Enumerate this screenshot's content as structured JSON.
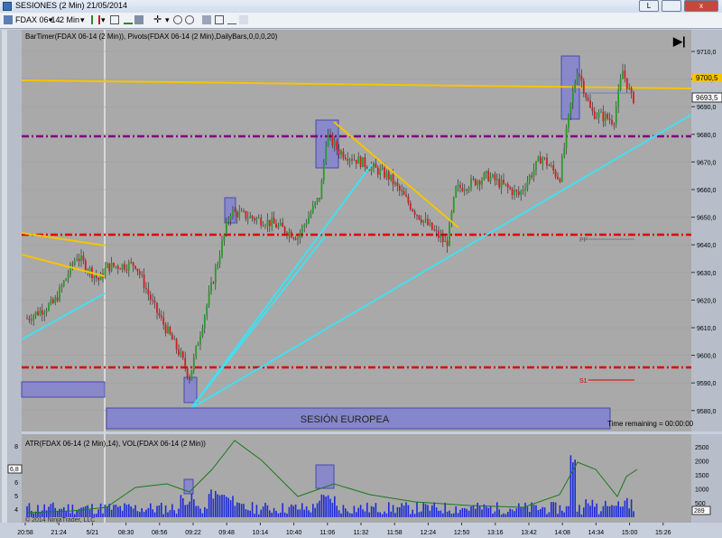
{
  "window": {
    "title": "SESIONES (2 Min)  21/05/2014",
    "min_label": "L",
    "close_label": "x"
  },
  "toolbar": {
    "instrument": "FDAX 06-14",
    "interval": "2 Min"
  },
  "price_panel": {
    "indicator_label": "BarTimer(FDAX 06-14 (2 Min)), Pivots(FDAX 06-14 (2 Min),DailyBars,0,0,0,20)",
    "price_ticks": [
      "9710,0",
      "9700,0",
      "9690,0",
      "9680,0",
      "9670,0",
      "9660,0",
      "9650,0",
      "9640,0",
      "9630,0",
      "9620,0",
      "9610,0",
      "9600,0",
      "9590,0",
      "9580,0"
    ],
    "price_ticks_num": [
      9710,
      9700,
      9690,
      9680,
      9670,
      9660,
      9650,
      9640,
      9630,
      9620,
      9610,
      9600,
      9590,
      9580
    ],
    "yellow_level_label": "9700,5",
    "last_price_label": "9693,5",
    "pivot_label": "PP",
    "s1_label": "S1",
    "session_label": "SESIÓN EUROPEA",
    "time_remaining": "Time remaining = 00:00:00",
    "colors": {
      "background": "#a9a9a9",
      "pivot": "#e00000",
      "r1": "#800080",
      "trend": "#40e0f0",
      "resistance": "#f5c400",
      "box": "#7b7bd8"
    }
  },
  "lower_panel": {
    "indicator_label": "ATR(FDAX 06-14 (2 Min),14), VOL(FDAX 06-14 (2 Min))",
    "atr_ticks": [
      "8",
      "6",
      "5",
      "4"
    ],
    "vol_ticks": [
      "2500",
      "2000",
      "1500",
      "1000",
      "500"
    ],
    "atr_marker": "6,8",
    "vol_marker": "289",
    "copyright": "© 2014 NinjaTrader, LLC"
  },
  "time_axis": [
    "20:58",
    "21:24",
    "5/21",
    "08:30",
    "08:56",
    "09:22",
    "09:48",
    "10:14",
    "10:40",
    "11:06",
    "11:32",
    "11:58",
    "12:24",
    "12:50",
    "13:16",
    "13:42",
    "14:08",
    "14:34",
    "15:00",
    "15:26"
  ],
  "controls": {
    "end_button": "▶|"
  }
}
